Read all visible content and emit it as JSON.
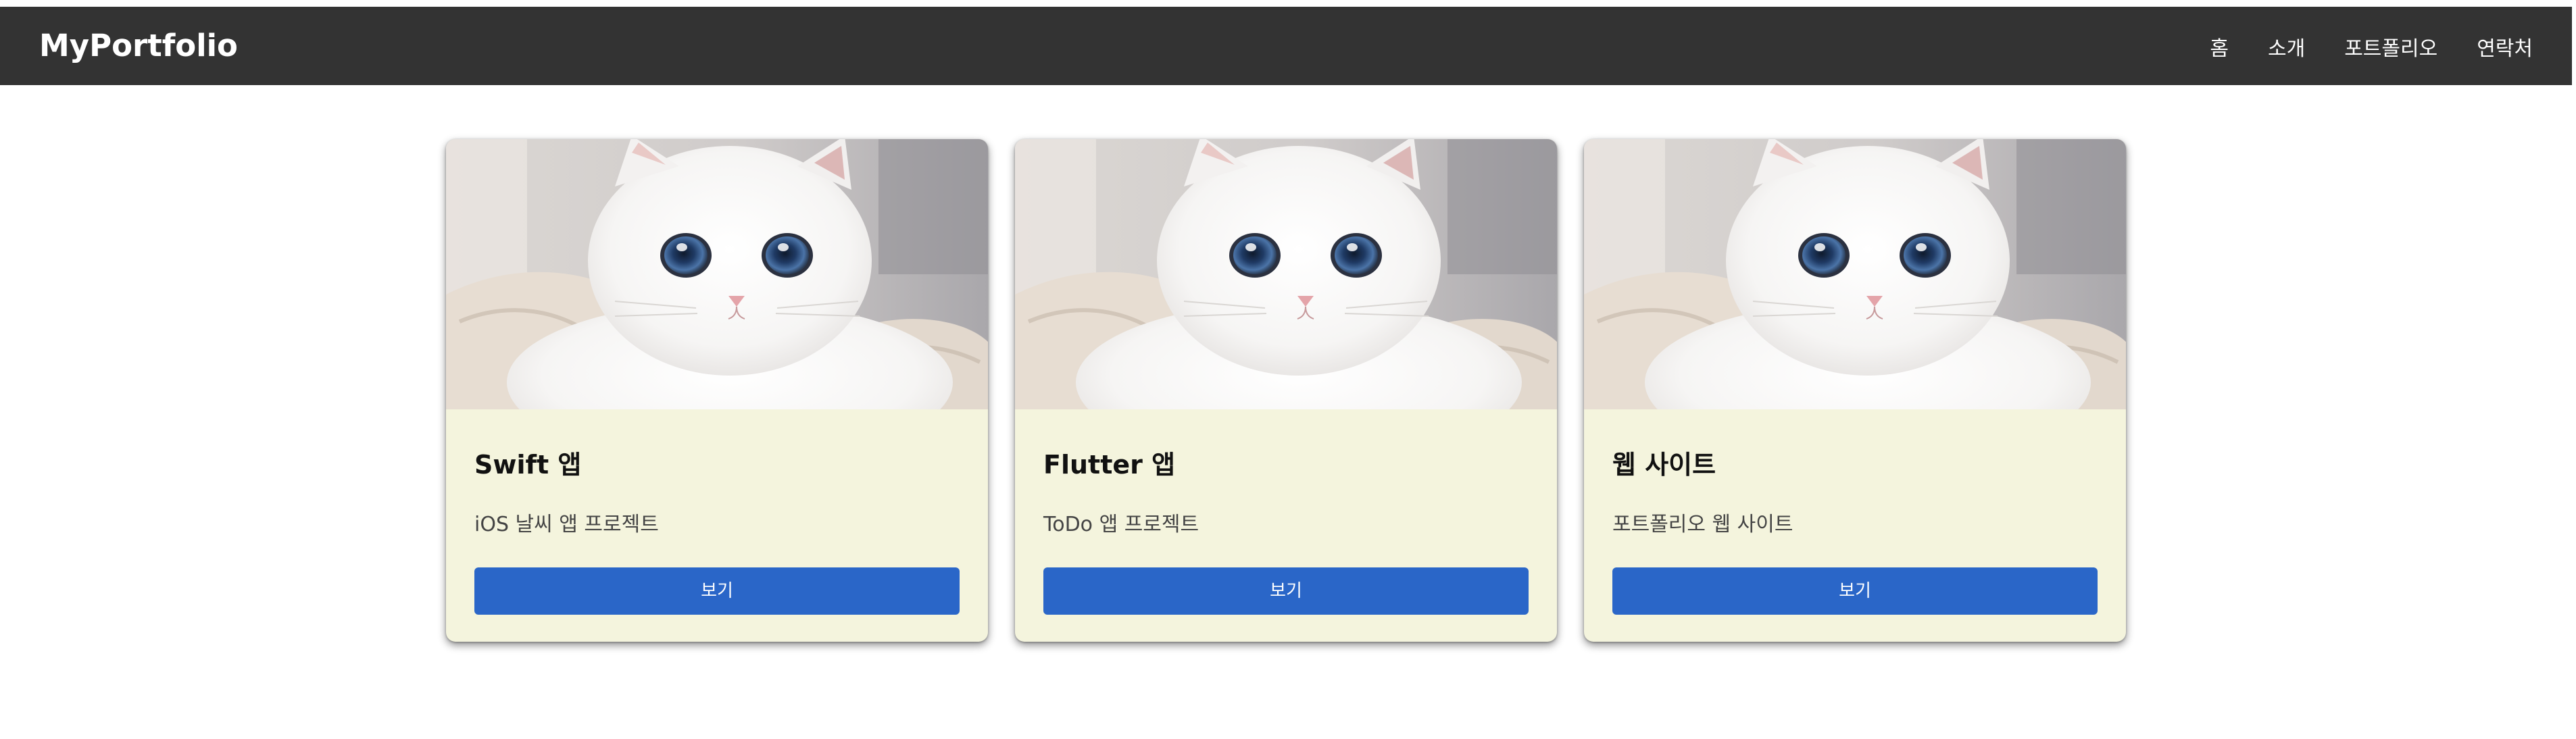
{
  "header": {
    "brand": "MyPortfolio",
    "nav": [
      "홈",
      "소개",
      "포트폴리오",
      "연락처"
    ]
  },
  "cards": [
    {
      "title": "Swift 앱",
      "description": "iOS 날씨 앱 프로젝트",
      "button_label": "보기",
      "image_alt": "white cat photo"
    },
    {
      "title": "Flutter 앱",
      "description": "ToDo 앱 프로젝트",
      "button_label": "보기",
      "image_alt": "white cat photo"
    },
    {
      "title": "웹 사이트",
      "description": "포트폴리오 웹 사이트",
      "button_label": "보기",
      "image_alt": "white cat photo"
    }
  ],
  "colors": {
    "header_bg": "#333333",
    "card_bg": "#f4f4dd",
    "button_bg": "#2a66c8"
  }
}
